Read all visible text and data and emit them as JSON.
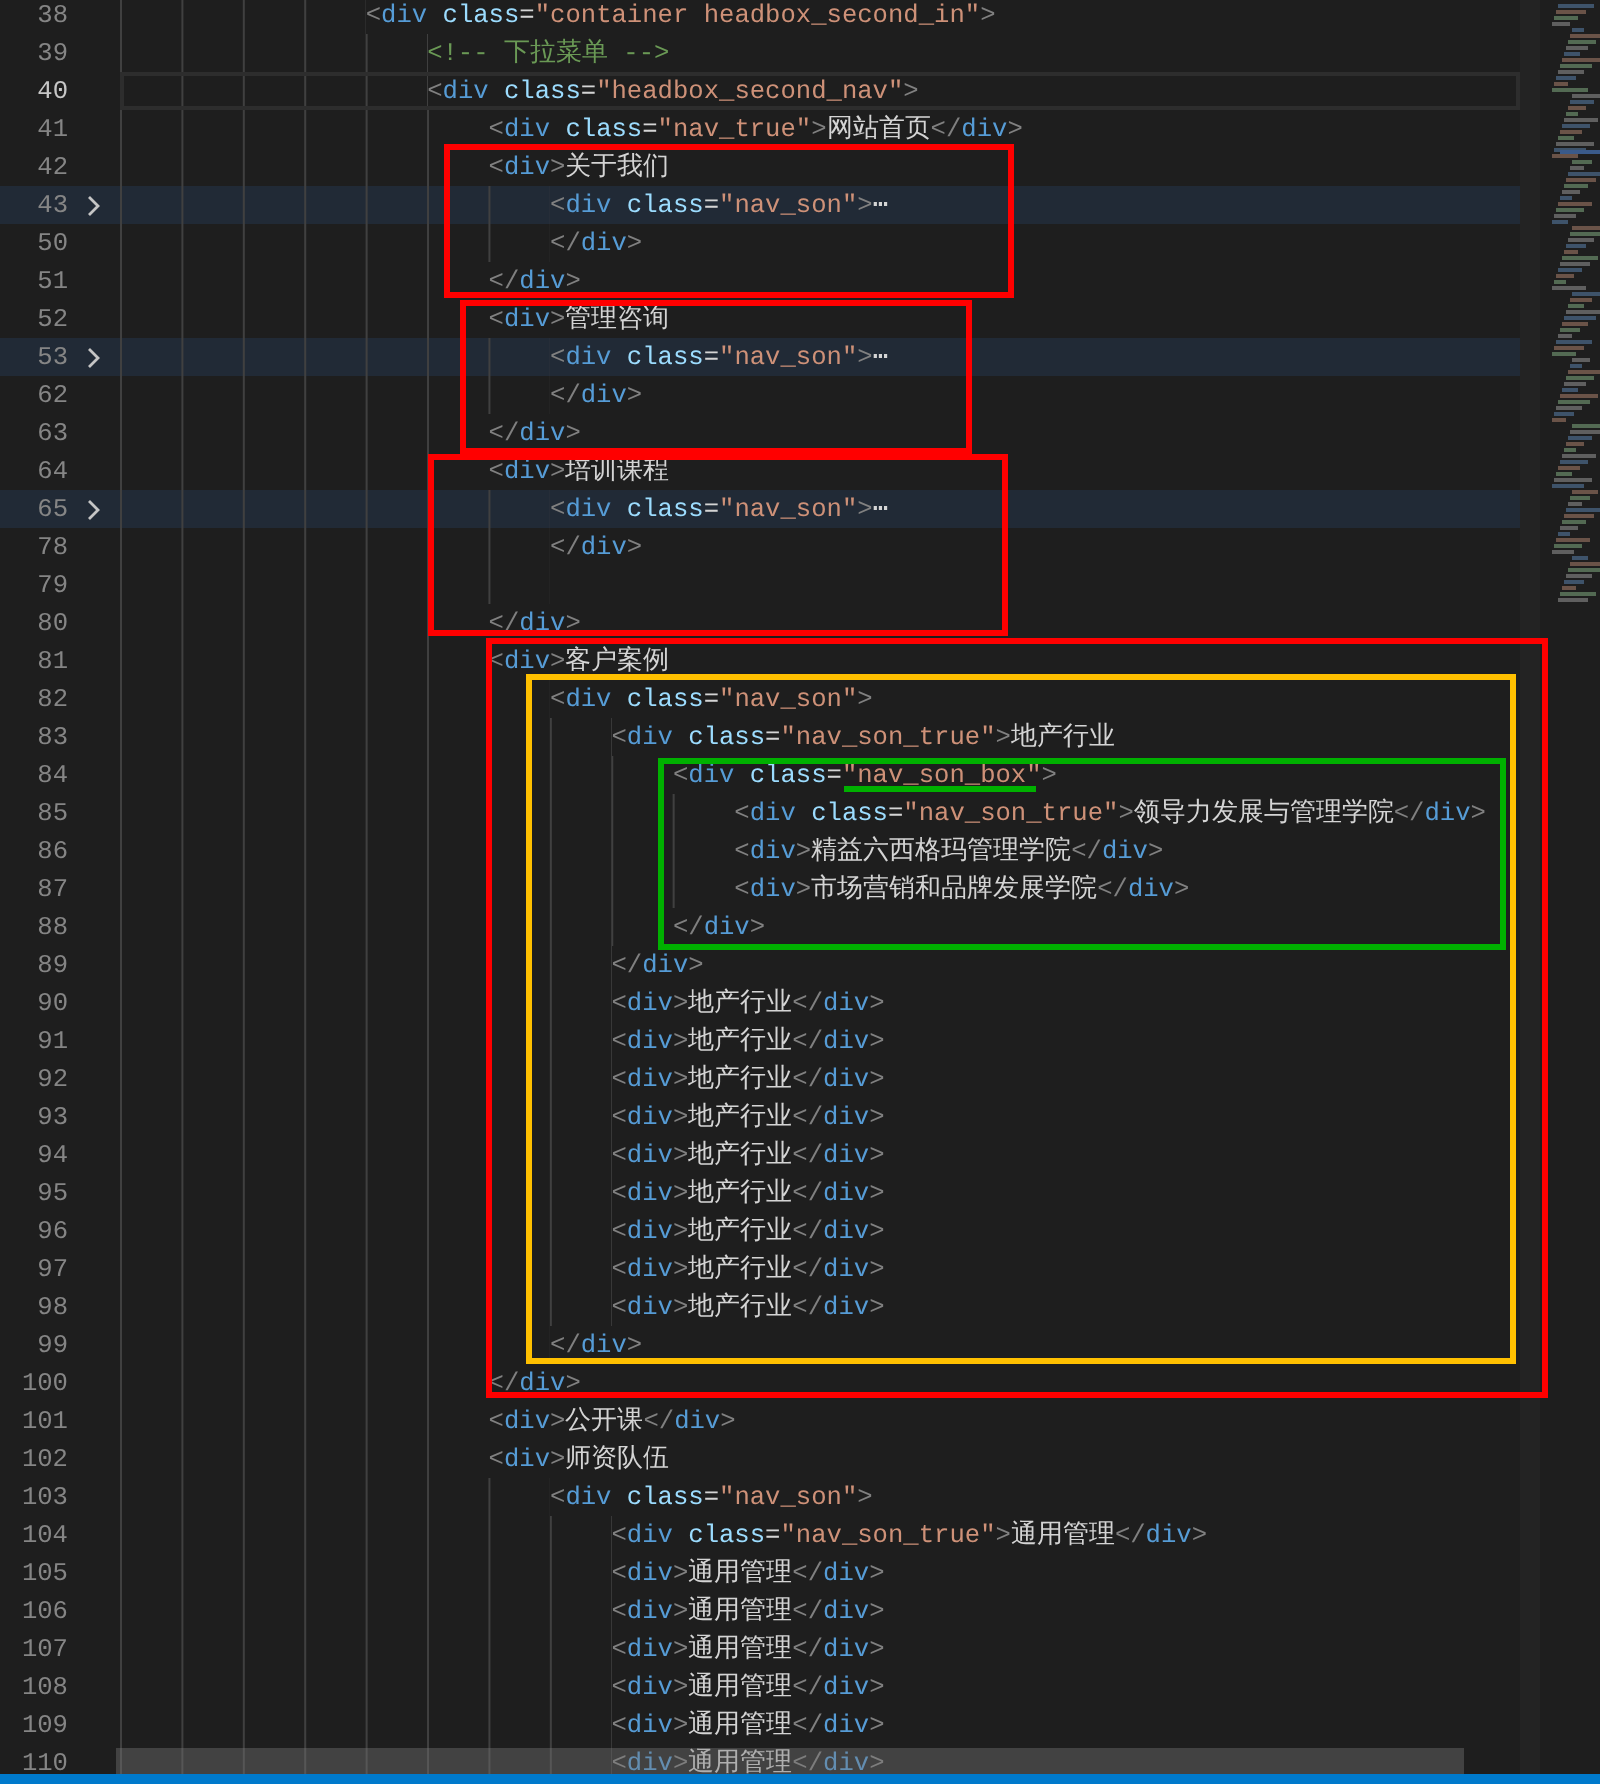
{
  "editor": {
    "lines": [
      {
        "number": "38",
        "current": false,
        "folded": false,
        "code": "<div class=\"container headbox_second_in\">",
        "children": [
          {
            "number": "39",
            "current": false,
            "folded": false,
            "code": "<!-- 下拉菜单 -->"
          },
          {
            "number": "40",
            "current": true,
            "folded": false,
            "code": "<div class=\"headbox_second_nav\">",
            "children": [
              {
                "number": "41",
                "current": false,
                "folded": false,
                "code": "<div class=\"nav_true\">网站首页</div>"
              },
              {
                "number": "42",
                "current": false,
                "folded": false,
                "code": "<div>关于我们",
                "children": [
                  {
                    "number": "43",
                    "current": false,
                    "folded": true,
                    "code": "<div class=\"nav_son\">⋯"
                  },
                  {
                    "number": "50",
                    "current": false,
                    "folded": false,
                    "code": "</div>"
                  }
                ]
              },
              {
                "number": "51",
                "current": false,
                "folded": false,
                "code": "</div>"
              },
              {
                "number": "52",
                "current": false,
                "folded": false,
                "code": "<div>管理咨询",
                "children": [
                  {
                    "number": "53",
                    "current": false,
                    "folded": true,
                    "code": "<div class=\"nav_son\">⋯"
                  },
                  {
                    "number": "62",
                    "current": false,
                    "folded": false,
                    "code": "</div>"
                  }
                ]
              },
              {
                "number": "63",
                "current": false,
                "folded": false,
                "code": "</div>"
              },
              {
                "number": "64",
                "current": false,
                "folded": false,
                "code": "<div>培训课程",
                "children": [
                  {
                    "number": "65",
                    "current": false,
                    "folded": true,
                    "code": "<div class=\"nav_son\">⋯"
                  },
                  {
                    "number": "78",
                    "current": false,
                    "folded": false,
                    "code": "</div>"
                  },
                  {
                    "number": "79",
                    "current": false,
                    "folded": false
                  }
                ]
              },
              {
                "number": "80",
                "current": false,
                "folded": false,
                "code": "</div>"
              },
              {
                "number": "81",
                "current": false,
                "folded": false,
                "code": "<div>客户案例",
                "children": [
                  {
                    "number": "82",
                    "current": false,
                    "folded": false,
                    "code": "<div class=\"nav_son\">",
                    "children": [
                      {
                        "number": "83",
                        "current": false,
                        "folded": false,
                        "code": "<div class=\"nav_son_true\">地产行业",
                        "children": [
                          {
                            "number": "84",
                            "current": false,
                            "folded": false,
                            "code": "<div class=\"nav_son_box\">",
                            "children": [
                              {
                                "number": "85",
                                "current": false,
                                "folded": false,
                                "code": "<div class=\"nav_son_true\">领导力发展与管理学院</div>"
                              },
                              {
                                "number": "86",
                                "current": false,
                                "folded": false,
                                "code": "<div>精益六西格玛管理学院</div>"
                              },
                              {
                                "number": "87",
                                "current": false,
                                "folded": false,
                                "code": "<div>市场营销和品牌发展学院</div>"
                              }
                            ]
                          },
                          {
                            "number": "88",
                            "current": false,
                            "folded": false,
                            "code": "</div>"
                          }
                        ]
                      },
                      {
                        "number": "89",
                        "current": false,
                        "folded": false,
                        "code": "</div>"
                      },
                      {
                        "number": "90",
                        "current": false,
                        "folded": false,
                        "code": "<div>地产行业</div>"
                      },
                      {
                        "number": "91",
                        "current": false,
                        "folded": false,
                        "code": "<div>地产行业</div>"
                      },
                      {
                        "number": "92",
                        "current": false,
                        "folded": false,
                        "code": "<div>地产行业</div>"
                      },
                      {
                        "number": "93",
                        "current": false,
                        "folded": false,
                        "code": "<div>地产行业</div>"
                      },
                      {
                        "number": "94",
                        "current": false,
                        "folded": false,
                        "code": "<div>地产行业</div>"
                      },
                      {
                        "number": "95",
                        "current": false,
                        "folded": false,
                        "code": "<div>地产行业</div>"
                      },
                      {
                        "number": "96",
                        "current": false,
                        "folded": false,
                        "code": "<div>地产行业</div>"
                      },
                      {
                        "number": "97",
                        "current": false,
                        "folded": false,
                        "code": "<div>地产行业</div>"
                      },
                      {
                        "number": "98",
                        "current": false,
                        "folded": false,
                        "code": "<div>地产行业</div>"
                      }
                    ]
                  },
                  {
                    "number": "99",
                    "current": false,
                    "folded": false,
                    "code": "</div>"
                  }
                ]
              },
              {
                "number": "100",
                "current": false,
                "folded": false,
                "code": "</div>"
              },
              {
                "number": "101",
                "current": false,
                "folded": false,
                "code": "<div>公开课</div>"
              },
              {
                "number": "102",
                "current": false,
                "folded": false,
                "code": "<div>师资队伍",
                "children": [
                  {
                    "number": "103",
                    "current": false,
                    "folded": false,
                    "code": "<div class=\"nav_son\">",
                    "children": [
                      {
                        "number": "104",
                        "current": false,
                        "folded": false,
                        "code": "<div class=\"nav_son_true\">通用管理</div>"
                      },
                      {
                        "number": "105",
                        "current": false,
                        "folded": false,
                        "code": "<div>通用管理</div>"
                      },
                      {
                        "number": "106",
                        "current": false,
                        "folded": false,
                        "code": "<div>通用管理</div>"
                      },
                      {
                        "number": "107",
                        "current": false,
                        "folded": false,
                        "code": "<div>通用管理</div>"
                      },
                      {
                        "number": "108",
                        "current": false,
                        "folded": false,
                        "code": "<div>通用管理</div>"
                      },
                      {
                        "number": "109",
                        "current": false,
                        "folded": false,
                        "code": "<div>通用管理</div>"
                      },
                      {
                        "number": "110",
                        "current": false,
                        "folded": false,
                        "code": "<div>通用管理</div>"
                      }
                    ]
                  }
                ]
              }
            ]
          }
        ]
      }
    ]
  },
  "annotations": [
    {
      "kind": "box",
      "color": "#ff0000"
    },
    {
      "kind": "box",
      "color": "#ff0000"
    },
    {
      "kind": "box",
      "color": "#ff0000"
    },
    {
      "kind": "box",
      "color": "#ff0000"
    },
    {
      "kind": "box",
      "color": "#ffc000"
    },
    {
      "kind": "box",
      "color": "#00b000"
    },
    {
      "kind": "underline",
      "color": "#00b000"
    }
  ]
}
